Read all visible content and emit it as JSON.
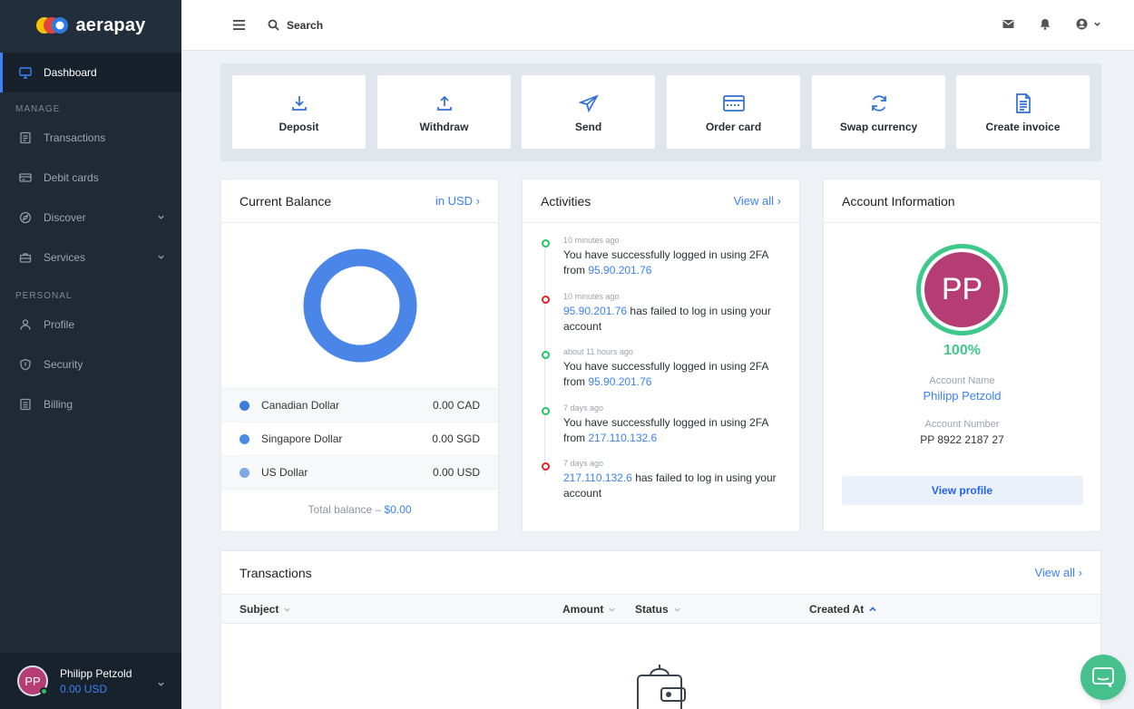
{
  "app": {
    "name": "aerapay"
  },
  "sidebar": {
    "dashboard": "Dashboard",
    "sections": {
      "manage": "MANAGE",
      "personal": "PERSONAL"
    },
    "manage_items": [
      "Transactions",
      "Debit cards",
      "Discover",
      "Services"
    ],
    "personal_items": [
      "Profile",
      "Security",
      "Billing"
    ],
    "user": {
      "initials": "PP",
      "name": "Philipp Petzold",
      "balance": "0.00 USD"
    }
  },
  "topbar": {
    "search_label": "Search"
  },
  "actions": [
    "Deposit",
    "Withdraw",
    "Send",
    "Order card",
    "Swap currency",
    "Create invoice"
  ],
  "balance": {
    "title": "Current Balance",
    "link": "in USD ›",
    "rows": [
      {
        "name": "Canadian Dollar",
        "value": "0.00 CAD",
        "color": "#3b7ddd"
      },
      {
        "name": "Singapore Dollar",
        "value": "0.00 SGD",
        "color": "#4a8be8"
      },
      {
        "name": "US Dollar",
        "value": "0.00 USD",
        "color": "#7fa8e6"
      }
    ],
    "total_label": "Total balance – ",
    "total_value": "$0.00",
    "donut_color": "#4a86e8"
  },
  "activities": {
    "title": "Activities",
    "link": "View all ›",
    "items": [
      {
        "time": "10 minutes ago",
        "status": "success",
        "pre": "You have successfully logged in using 2FA from ",
        "ip": "95.90.201.76",
        "post": ""
      },
      {
        "time": "10 minutes ago",
        "status": "fail",
        "pre": "",
        "ip": "95.90.201.76",
        "post": " has failed to log in using your account"
      },
      {
        "time": "about 11 hours ago",
        "status": "success",
        "pre": "You have successfully logged in using 2FA from ",
        "ip": "95.90.201.76",
        "post": ""
      },
      {
        "time": "7 days ago",
        "status": "success",
        "pre": "You have successfully logged in using 2FA from ",
        "ip": "217.110.132.6",
        "post": ""
      },
      {
        "time": "7 days ago",
        "status": "fail",
        "pre": "",
        "ip": "217.110.132.6",
        "post": " has failed to log in using your account"
      }
    ]
  },
  "account": {
    "title": "Account Information",
    "initials": "PP",
    "completion": "100%",
    "name_label": "Account Name",
    "name": "Philipp Petzold",
    "number_label": "Account Number",
    "number": "PP 8922 2187 27",
    "button": "View profile"
  },
  "transactions": {
    "title": "Transactions",
    "link": "View all ›",
    "columns": [
      "Subject",
      "Amount",
      "Status",
      "Created At"
    ]
  }
}
